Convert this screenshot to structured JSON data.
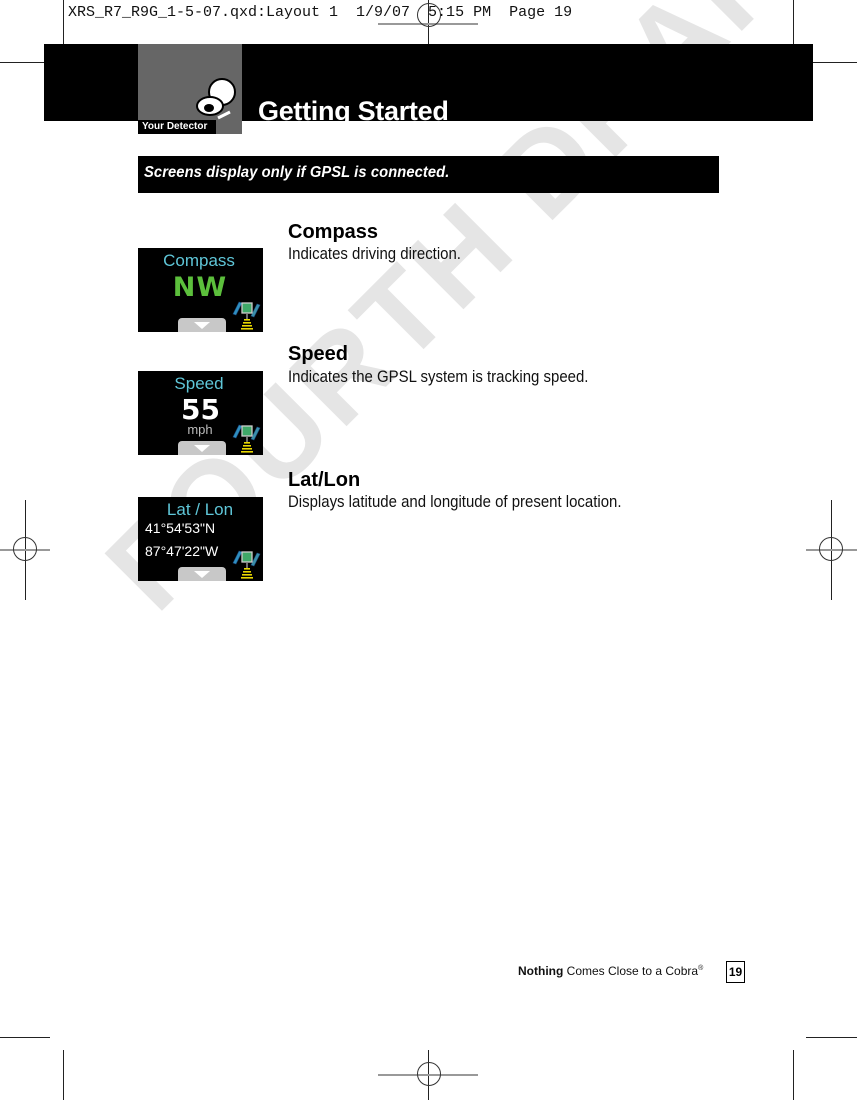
{
  "slug_line": "XRS_R7_R9G_1-5-07.qxd:Layout 1  1/9/07  5:15 PM  Page 19",
  "header": {
    "section_tab": "Your Detector",
    "title": "Getting Started"
  },
  "note": "Screens display only if GPSL is connected.",
  "items": [
    {
      "title": "Compass",
      "description": "Indicates driving direction.",
      "screen": {
        "label": "Compass",
        "value": "NW",
        "value_color": "#5cbf3c"
      }
    },
    {
      "title": "Speed",
      "description": "Indicates the GPSL system is tracking speed.",
      "screen": {
        "label": "Speed",
        "value": "55",
        "unit": "mph",
        "value_color": "#ffffff"
      }
    },
    {
      "title": "Lat/Lon",
      "description": "Displays latitude and longitude of present location.",
      "screen": {
        "label": "Lat / Lon",
        "lat": "41°54'53\"N",
        "lon": "87°47'22\"W"
      }
    }
  ],
  "footer": {
    "tagline_bold": "Nothing",
    "tagline_rest": " Comes Close to a Cobra",
    "registered": "®",
    "page_number": "19"
  },
  "watermark": "FOURTH DRAFT",
  "colors": {
    "screen_label": "#5fc6d8",
    "compass_value": "#5cbf3c",
    "header_bg": "#000000",
    "section_tab_bg": "#666666"
  }
}
